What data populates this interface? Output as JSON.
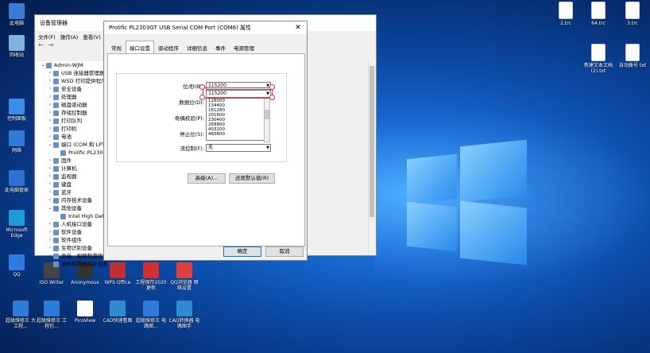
{
  "desktop": {
    "left_icons": [
      {
        "name": "此电脑-icon",
        "label": "此电脑"
      },
      {
        "name": "回收站-icon",
        "label": "回收站"
      },
      {
        "name": "控制面板-icon",
        "label": "控制面板"
      },
      {
        "name": "网络-icon",
        "label": "网络"
      },
      {
        "name": "windows-defender-icon",
        "label": "此电脑管家"
      },
      {
        "name": "edge-icon",
        "label": "Microsoft Edge"
      },
      {
        "name": "qq-icon",
        "label": "QQ"
      }
    ],
    "bottom_icons": [
      {
        "label": "ISO Writer"
      },
      {
        "label": "Anonymous"
      },
      {
        "label": "WPS Office"
      },
      {
        "label": "工程保存2020 更新"
      },
      {
        "label": "QQ浏览器 网络设置"
      },
      {
        "label": "超级维修王 大工程..."
      },
      {
        "label": "超级维修王 工程包..."
      },
      {
        "label": "PicoView"
      },
      {
        "label": "CAD快速看图"
      },
      {
        "label": "超级维修王 电路图..."
      },
      {
        "label": "CAD转换器 电路图手"
      }
    ],
    "right_icons": [
      {
        "label": "2.trc"
      },
      {
        "label": "64.trc"
      },
      {
        "label": "3.trc"
      },
      {
        "label": "新建文本文档 (2).txt"
      },
      {
        "label": "自动拨号 txt"
      }
    ]
  },
  "device_manager": {
    "title": "设备管理器",
    "menu": [
      "文件(F)",
      "操作(A)",
      "查看(V)"
    ],
    "tree": [
      {
        "label": "Admin-WJM",
        "indent": 0,
        "twisty": "⌄"
      },
      {
        "label": "USB 连接器管理器",
        "indent": 1,
        "twisty": "›"
      },
      {
        "label": "WSD 打印提供程序",
        "indent": 1,
        "twisty": "›"
      },
      {
        "label": "安全设备",
        "indent": 1,
        "twisty": "›"
      },
      {
        "label": "处理器",
        "indent": 1,
        "twisty": "›"
      },
      {
        "label": "磁盘驱动器",
        "indent": 1,
        "twisty": "›"
      },
      {
        "label": "存储控制器",
        "indent": 1,
        "twisty": "›"
      },
      {
        "label": "打印队列",
        "indent": 1,
        "twisty": "›"
      },
      {
        "label": "打印机",
        "indent": 1,
        "twisty": "›"
      },
      {
        "label": "电池",
        "indent": 1,
        "twisty": "›"
      },
      {
        "label": "端口 (COM 和 LPT)",
        "indent": 1,
        "twisty": "⌄"
      },
      {
        "label": "Prolific PL2303GT USB Serial COM Port (COM6)",
        "indent": 2,
        "twisty": ""
      },
      {
        "label": "固件",
        "indent": 1,
        "twisty": "›"
      },
      {
        "label": "计算机",
        "indent": 1,
        "twisty": "›"
      },
      {
        "label": "监视器",
        "indent": 1,
        "twisty": "›"
      },
      {
        "label": "键盘",
        "indent": 1,
        "twisty": "›"
      },
      {
        "label": "蓝牙",
        "indent": 1,
        "twisty": "›"
      },
      {
        "label": "内存技术设备",
        "indent": 1,
        "twisty": "›"
      },
      {
        "label": "其他设备",
        "indent": 1,
        "twisty": "⌄"
      },
      {
        "label": "Intel High Definition DSP",
        "indent": 2,
        "twisty": ""
      },
      {
        "label": "人机接口设备",
        "indent": 1,
        "twisty": "›"
      },
      {
        "label": "软件设备",
        "indent": 1,
        "twisty": "›"
      },
      {
        "label": "软件组件",
        "indent": 1,
        "twisty": "›"
      },
      {
        "label": "生物识别设备",
        "indent": 1,
        "twisty": "›"
      },
      {
        "label": "声音、视频和游戏控制器",
        "indent": 1,
        "twisty": "›"
      },
      {
        "label": "鼠标和其他指针设备",
        "indent": 1,
        "twisty": "›"
      }
    ]
  },
  "dialog": {
    "title": "Prolific PL2303GT USB Serial COM Port (COM6) 属性",
    "tabs": [
      "常规",
      "端口设置",
      "驱动程序",
      "详细信息",
      "事件",
      "电源管理"
    ],
    "active_tab": "端口设置",
    "fields": {
      "baud_label": "位/秒(B):",
      "baud_value": "115200",
      "databits_label": "数据位(D):",
      "parity_label": "奇偶校验(P):",
      "stopbits_label": "停止位(S):",
      "flow_label": "流控制(F):",
      "flow_value": "无"
    },
    "dropdown_selected": "115200",
    "dropdown_options": [
      "128000",
      "134400",
      "161280",
      "201600",
      "230400",
      "268800",
      "403200",
      "460800"
    ],
    "advanced_button": "高级(A)...",
    "restore_button": "还原默认值(R)",
    "ok_button": "确定",
    "cancel_button": "取消",
    "close_glyph": "✕"
  },
  "colors": {
    "highlight": "#e03030",
    "accent": "#0078d7"
  }
}
